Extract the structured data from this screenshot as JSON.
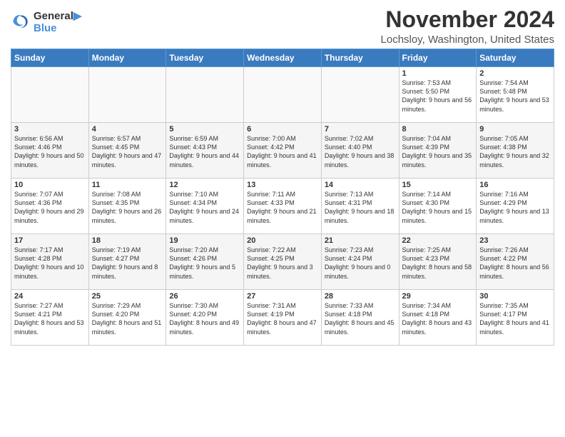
{
  "logo": {
    "line1": "General",
    "line2": "Blue"
  },
  "title": "November 2024",
  "location": "Lochsloy, Washington, United States",
  "days_of_week": [
    "Sunday",
    "Monday",
    "Tuesday",
    "Wednesday",
    "Thursday",
    "Friday",
    "Saturday"
  ],
  "weeks": [
    [
      {
        "day": "",
        "info": ""
      },
      {
        "day": "",
        "info": ""
      },
      {
        "day": "",
        "info": ""
      },
      {
        "day": "",
        "info": ""
      },
      {
        "day": "",
        "info": ""
      },
      {
        "day": "1",
        "info": "Sunrise: 7:53 AM\nSunset: 5:50 PM\nDaylight: 9 hours and 56 minutes."
      },
      {
        "day": "2",
        "info": "Sunrise: 7:54 AM\nSunset: 5:48 PM\nDaylight: 9 hours and 53 minutes."
      }
    ],
    [
      {
        "day": "3",
        "info": "Sunrise: 6:56 AM\nSunset: 4:46 PM\nDaylight: 9 hours and 50 minutes."
      },
      {
        "day": "4",
        "info": "Sunrise: 6:57 AM\nSunset: 4:45 PM\nDaylight: 9 hours and 47 minutes."
      },
      {
        "day": "5",
        "info": "Sunrise: 6:59 AM\nSunset: 4:43 PM\nDaylight: 9 hours and 44 minutes."
      },
      {
        "day": "6",
        "info": "Sunrise: 7:00 AM\nSunset: 4:42 PM\nDaylight: 9 hours and 41 minutes."
      },
      {
        "day": "7",
        "info": "Sunrise: 7:02 AM\nSunset: 4:40 PM\nDaylight: 9 hours and 38 minutes."
      },
      {
        "day": "8",
        "info": "Sunrise: 7:04 AM\nSunset: 4:39 PM\nDaylight: 9 hours and 35 minutes."
      },
      {
        "day": "9",
        "info": "Sunrise: 7:05 AM\nSunset: 4:38 PM\nDaylight: 9 hours and 32 minutes."
      }
    ],
    [
      {
        "day": "10",
        "info": "Sunrise: 7:07 AM\nSunset: 4:36 PM\nDaylight: 9 hours and 29 minutes."
      },
      {
        "day": "11",
        "info": "Sunrise: 7:08 AM\nSunset: 4:35 PM\nDaylight: 9 hours and 26 minutes."
      },
      {
        "day": "12",
        "info": "Sunrise: 7:10 AM\nSunset: 4:34 PM\nDaylight: 9 hours and 24 minutes."
      },
      {
        "day": "13",
        "info": "Sunrise: 7:11 AM\nSunset: 4:33 PM\nDaylight: 9 hours and 21 minutes."
      },
      {
        "day": "14",
        "info": "Sunrise: 7:13 AM\nSunset: 4:31 PM\nDaylight: 9 hours and 18 minutes."
      },
      {
        "day": "15",
        "info": "Sunrise: 7:14 AM\nSunset: 4:30 PM\nDaylight: 9 hours and 15 minutes."
      },
      {
        "day": "16",
        "info": "Sunrise: 7:16 AM\nSunset: 4:29 PM\nDaylight: 9 hours and 13 minutes."
      }
    ],
    [
      {
        "day": "17",
        "info": "Sunrise: 7:17 AM\nSunset: 4:28 PM\nDaylight: 9 hours and 10 minutes."
      },
      {
        "day": "18",
        "info": "Sunrise: 7:19 AM\nSunset: 4:27 PM\nDaylight: 9 hours and 8 minutes."
      },
      {
        "day": "19",
        "info": "Sunrise: 7:20 AM\nSunset: 4:26 PM\nDaylight: 9 hours and 5 minutes."
      },
      {
        "day": "20",
        "info": "Sunrise: 7:22 AM\nSunset: 4:25 PM\nDaylight: 9 hours and 3 minutes."
      },
      {
        "day": "21",
        "info": "Sunrise: 7:23 AM\nSunset: 4:24 PM\nDaylight: 9 hours and 0 minutes."
      },
      {
        "day": "22",
        "info": "Sunrise: 7:25 AM\nSunset: 4:23 PM\nDaylight: 8 hours and 58 minutes."
      },
      {
        "day": "23",
        "info": "Sunrise: 7:26 AM\nSunset: 4:22 PM\nDaylight: 8 hours and 56 minutes."
      }
    ],
    [
      {
        "day": "24",
        "info": "Sunrise: 7:27 AM\nSunset: 4:21 PM\nDaylight: 8 hours and 53 minutes."
      },
      {
        "day": "25",
        "info": "Sunrise: 7:29 AM\nSunset: 4:20 PM\nDaylight: 8 hours and 51 minutes."
      },
      {
        "day": "26",
        "info": "Sunrise: 7:30 AM\nSunset: 4:20 PM\nDaylight: 8 hours and 49 minutes."
      },
      {
        "day": "27",
        "info": "Sunrise: 7:31 AM\nSunset: 4:19 PM\nDaylight: 8 hours and 47 minutes."
      },
      {
        "day": "28",
        "info": "Sunrise: 7:33 AM\nSunset: 4:18 PM\nDaylight: 8 hours and 45 minutes."
      },
      {
        "day": "29",
        "info": "Sunrise: 7:34 AM\nSunset: 4:18 PM\nDaylight: 8 hours and 43 minutes."
      },
      {
        "day": "30",
        "info": "Sunrise: 7:35 AM\nSunset: 4:17 PM\nDaylight: 8 hours and 41 minutes."
      }
    ]
  ]
}
